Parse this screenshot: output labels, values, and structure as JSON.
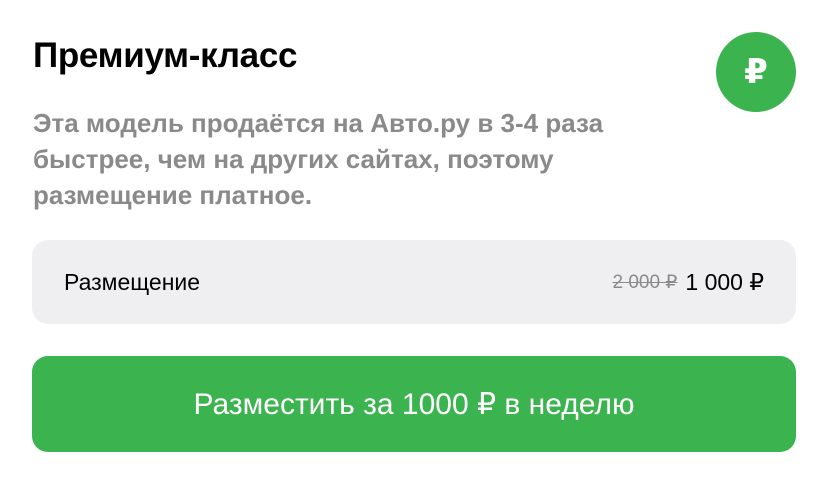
{
  "header": {
    "title": "Премиум-класс",
    "badge_symbol": "₽",
    "badge_color": "#3bb44f"
  },
  "description": "Эта модель продаётся на Авто.ру в 3-4 раза быстрее, чем на других сайтах, поэтому размещение платное.",
  "pricing": {
    "label": "Размещение",
    "old_price": "2 000 ₽",
    "new_price": "1 000 ₽"
  },
  "cta": {
    "label": "Разместить за 1000 ₽ в неделю",
    "color": "#3bb44f"
  }
}
